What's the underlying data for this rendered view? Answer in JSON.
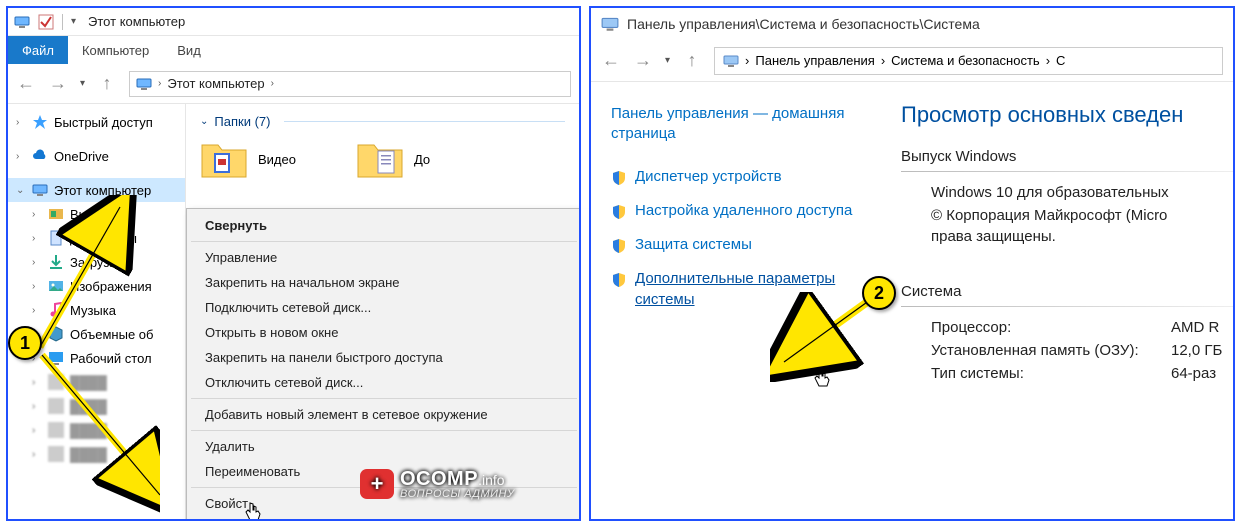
{
  "left": {
    "title": "Этот компьютер",
    "ribbon": {
      "file": "Файл",
      "tabs": [
        "Компьютер",
        "Вид"
      ]
    },
    "address": {
      "root": "Этот компьютер"
    },
    "tree": {
      "quick": "Быстрый доступ",
      "onedrive": "OneDrive",
      "thispc": "Этот компьютер",
      "children": [
        "Вид",
        "Документы",
        "Загрузки",
        "Изображения",
        "Музыка",
        "Объемные об",
        "Рабочий стол"
      ]
    },
    "content": {
      "group": "Папки (7)",
      "items": [
        "Видео",
        "До"
      ]
    },
    "context_menu": {
      "bold": "Свернуть",
      "items1": [
        "Управление",
        "Закрепить на начальном экране",
        "Подключить сетевой диск...",
        "Открыть в новом окне",
        "Закрепить на панели быстрого доступа",
        "Отключить сетевой диск..."
      ],
      "items2": [
        "Добавить новый элемент в сетевое окружение"
      ],
      "items3": [
        "Удалить",
        "Переименовать"
      ],
      "items4": [
        "Свойст"
      ]
    }
  },
  "right": {
    "title_path": "Панель управления\\Система и безопасность\\Система",
    "crumbs": [
      "Панель управления",
      "Система и безопасность",
      "С"
    ],
    "home": "Панель управления — домашняя страница",
    "links": [
      "Диспетчер устройств",
      "Настройка удаленного доступа",
      "Защита системы",
      "Дополнительные параметры системы"
    ],
    "heading": "Просмотр основных сведен",
    "edition_title": "Выпуск Windows",
    "edition_value": "Windows 10 для образовательных",
    "copyright": "© Корпорация Майкрософт (Micro",
    "copyright2": "права защищены.",
    "system_title": "Система",
    "rows": [
      {
        "k": "Процессор:",
        "v": "AMD R"
      },
      {
        "k": "Установленная память (ОЗУ):",
        "v": "12,0 ГБ"
      },
      {
        "k": "Тип системы:",
        "v": "64-раз"
      }
    ]
  },
  "markers": {
    "one": "1",
    "two": "2"
  },
  "watermark": {
    "plus": "+",
    "brand": "OCOMP",
    "tld": ".info",
    "sub": "ВОПРОСЫ АДМИНУ"
  }
}
